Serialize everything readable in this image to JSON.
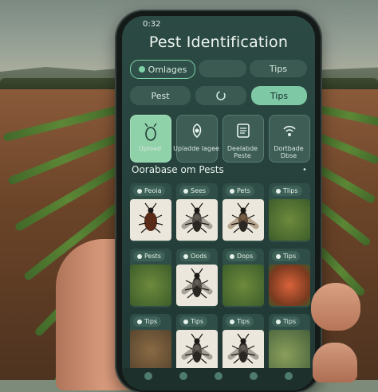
{
  "status": {
    "time": "0:32"
  },
  "app": {
    "title": "Pest Identification"
  },
  "tabs": [
    {
      "label": "Omlages"
    },
    {
      "label": ""
    },
    {
      "label": "Tips"
    }
  ],
  "subtabs": [
    {
      "label": "Pest"
    },
    {
      "label": ""
    },
    {
      "label": "Tips"
    }
  ],
  "features": [
    {
      "label": "Upload",
      "icon": "bug-icon"
    },
    {
      "label": "Upladde Iagee",
      "icon": "leaf-bug-icon"
    },
    {
      "label": "Deelabde Peste",
      "icon": "document-icon"
    },
    {
      "label": "Dortbade Dbse",
      "icon": "wifi-scan-icon"
    }
  ],
  "section": {
    "title": "Oorabase om Pests",
    "marker": "•"
  },
  "cards": [
    {
      "tag": "Peoia",
      "image": "beetle"
    },
    {
      "tag": "Sees",
      "image": "fly"
    },
    {
      "tag": "Pets",
      "image": "moth"
    },
    {
      "tag": "Tlips",
      "image": "leaf"
    },
    {
      "tag": "Pests",
      "image": "leaf"
    },
    {
      "tag": "Oods",
      "image": "fly"
    },
    {
      "tag": "Dops",
      "image": "leaf"
    },
    {
      "tag": "Tips",
      "image": "flower"
    },
    {
      "tag": "Tips",
      "image": "soil"
    },
    {
      "tag": "Tips",
      "image": "fly"
    },
    {
      "tag": "Tips",
      "image": "mosquito"
    },
    {
      "tag": "Tips",
      "image": "moss"
    }
  ],
  "colors": {
    "accent": "#7fd0a7",
    "screen": "#27423d",
    "mint": "#8fd1a9"
  }
}
